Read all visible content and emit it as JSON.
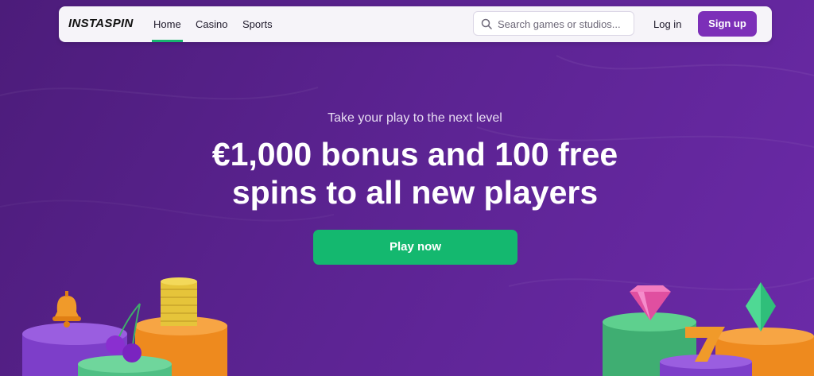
{
  "brand": {
    "logo_text": "INSTASPIN"
  },
  "nav": {
    "links": [
      {
        "label": "Home",
        "active": true
      },
      {
        "label": "Casino",
        "active": false
      },
      {
        "label": "Sports",
        "active": false
      }
    ],
    "search_placeholder": "Search games or studios...",
    "login_label": "Log in",
    "signup_label": "Sign up"
  },
  "hero": {
    "tagline": "Take your play to the next level",
    "headline_line1": "€1,000 bonus and 100 free",
    "headline_line2": "spins to all new players",
    "cta_label": "Play now"
  },
  "colors": {
    "background": "#5b2391",
    "accent_green": "#14b86f",
    "signup_purple": "#7c2fb8"
  },
  "icons": [
    "search-icon",
    "bell-icon",
    "cherries-icon",
    "coin-stack-icon",
    "gem-icon",
    "seven-icon",
    "diamond-icon"
  ]
}
